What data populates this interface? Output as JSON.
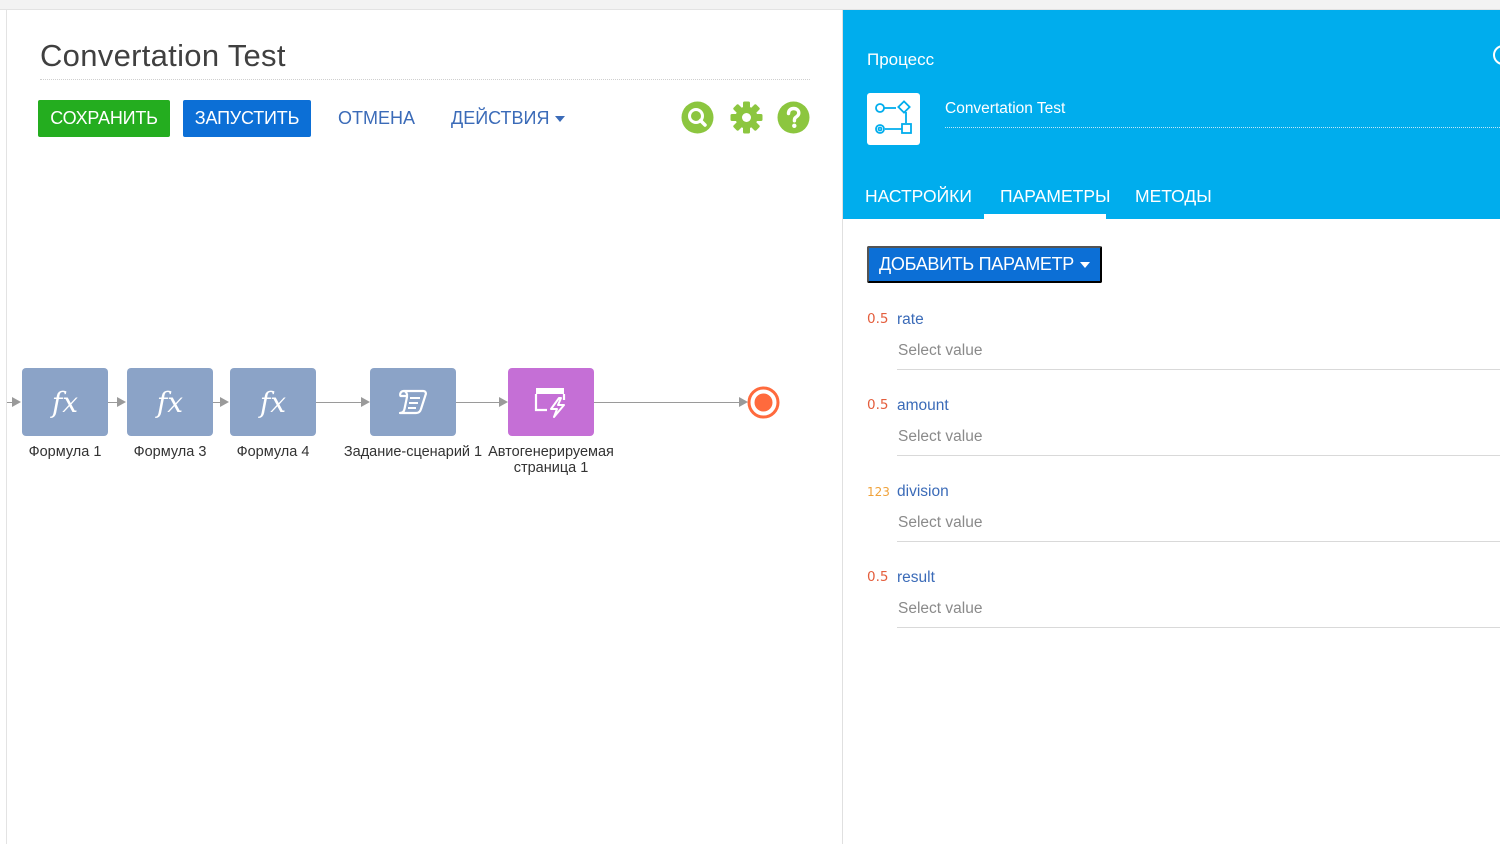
{
  "process": {
    "title": "Convertation Test"
  },
  "toolbar": {
    "save_label": "СОХРАНИТЬ",
    "run_label": "ЗАПУСТИТЬ",
    "cancel_label": "ОТМЕНА",
    "actions_label": "ДЕЙСТВИЯ",
    "icons": [
      "search-icon",
      "gear-icon",
      "help-icon"
    ],
    "colors": {
      "save": "#24ad1f",
      "run": "#0c6fd6",
      "tool_icons": "#8cc63f"
    }
  },
  "diagram": {
    "elements": [
      {
        "label": "Формула 1",
        "type": "formula",
        "icon": "fx"
      },
      {
        "label": "Формула 3",
        "type": "formula",
        "icon": "fx"
      },
      {
        "label": "Формула 4",
        "type": "formula",
        "icon": "fx"
      },
      {
        "label": "Задание-сценарий 1",
        "type": "script-task",
        "icon": "script-icon"
      },
      {
        "label": "Автогенерируемая страница 1",
        "type": "auto-page",
        "icon": "page-lightning-icon"
      }
    ],
    "end_event_icon": "end-event-icon",
    "colors": {
      "task": "#8ba3c7",
      "auto_page": "#c56fd6",
      "end_event": "#ff6a3d"
    }
  },
  "panel": {
    "section_label": "Процесс",
    "process_name": "Convertation Test",
    "process_icon": "process-diagram-icon",
    "tabs": [
      {
        "label": "НАСТРОЙКИ",
        "active": false
      },
      {
        "label": "ПАРАМЕТРЫ",
        "active": true
      },
      {
        "label": "МЕТОДЫ",
        "active": false
      }
    ],
    "add_parameter_label": "ДОБАВИТЬ ПАРАМЕТР",
    "colors": {
      "header": "#00aded"
    },
    "parameters": [
      {
        "type_badge": "0.5",
        "name": "rate",
        "value": "Select value"
      },
      {
        "type_badge": "0.5",
        "name": "amount",
        "value": "Select value"
      },
      {
        "type_badge": "123",
        "name": "division",
        "value": "Select value"
      },
      {
        "type_badge": "0.5",
        "name": "result",
        "value": "Select value"
      }
    ]
  }
}
